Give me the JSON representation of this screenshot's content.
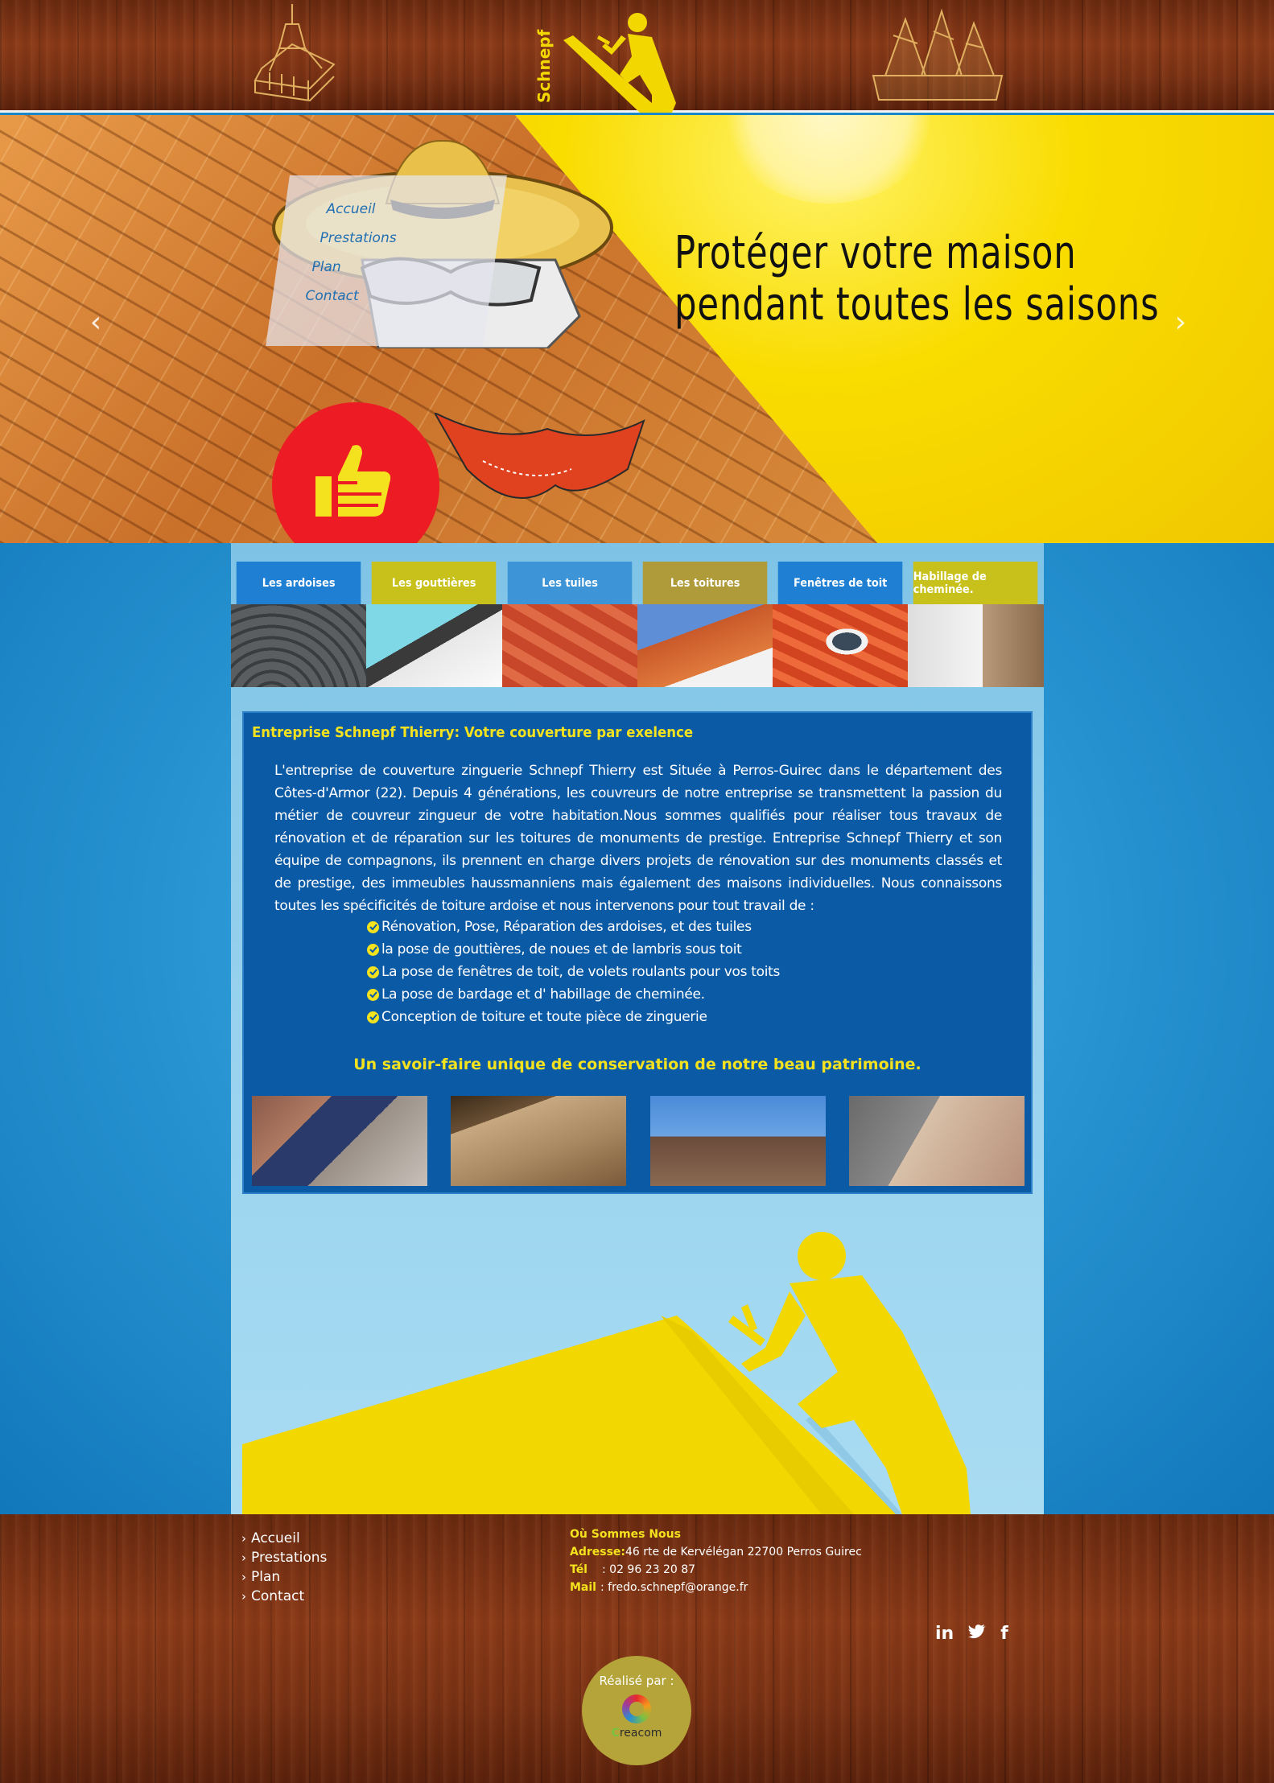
{
  "header": {
    "logo_text": "Schnepf"
  },
  "hero": {
    "title": "Protéger votre maison pendant toutes les saisons",
    "prev_arrow": "‹",
    "next_arrow": "›",
    "nav": [
      "Accueil",
      "Prestations",
      "Plan",
      "Contact"
    ]
  },
  "categories": [
    {
      "label": "Les ardoises",
      "color": "#1e7fd3",
      "icon": "slate-roof-image"
    },
    {
      "label": "Les gouttières",
      "color": "#c9c11b",
      "icon": "gutter-image"
    },
    {
      "label": "Les tuiles",
      "color": "#3d94d6",
      "icon": "tiles-image"
    },
    {
      "label": "Les toitures",
      "color": "#b09b3a",
      "icon": "roofs-image"
    },
    {
      "label": "Fenêtres de toit",
      "color": "#1e7fd3",
      "icon": "roof-window-image"
    },
    {
      "label": "Habillage de cheminée.",
      "color": "#c9c11b",
      "icon": "fireplace-image"
    }
  ],
  "info": {
    "title_prefix": "Entreprise ",
    "title_brand": "Schnepf Thierry",
    "title_suffix": ": Votre couverture par exelence",
    "paragraph": "L'entreprise de couverture zinguerie Schnepf Thierry est Située à Perros-Guirec dans le département des Côtes-d'Armor (22). Depuis 4 générations, les couvreurs de notre entreprise se transmettent la passion du métier de couvreur zingueur de votre habitation.Nous sommes qualifiés pour réaliser tous travaux de rénovation et de réparation sur les toitures de monuments de prestige. Entreprise Schnepf Thierry et son équipe de compagnons, ils prennent en charge divers projets de rénovation sur des monuments classés et de prestige, des immeubles haussmanniens mais également des maisons individuelles. Nous connaissons toutes les spécificités de toiture ardoise et nous intervenons pour tout travail de :",
    "list": [
      "Rénovation, Pose, Réparation des ardoises, et des tuiles",
      "la pose de gouttières, de noues et de lambris sous toit",
      "La pose de fenêtres de toit, de volets roulants pour vos toits",
      "La pose de bardage et d' habillage de cheminée.",
      "Conception de toiture et toute pièce de zinguerie"
    ],
    "slogan": "Un savoir-faire unique de conservation de notre beau patrimoine."
  },
  "footer": {
    "links": [
      "Accueil",
      "Prestations",
      "Plan",
      "Contact"
    ],
    "contact_title": "Où Sommes Nous",
    "address_label": "Adresse:",
    "address": "46 rte de Kervélégan 22700 Perros Guirec",
    "tel_label": "Tél",
    "tel": ": 02 96 23 20 87",
    "mail_label": "Mail",
    "mail": ": fredo.schnepf@orange.fr",
    "socials": [
      "in",
      "twitter",
      "f"
    ],
    "realise_label": "Réalisé par :",
    "agency_c": "C",
    "agency_rest": "reacom"
  },
  "colors": {
    "accent_yellow": "#f4e21e",
    "info_blue": "#0a5aa5",
    "thumb_red": "#ed1c24"
  }
}
